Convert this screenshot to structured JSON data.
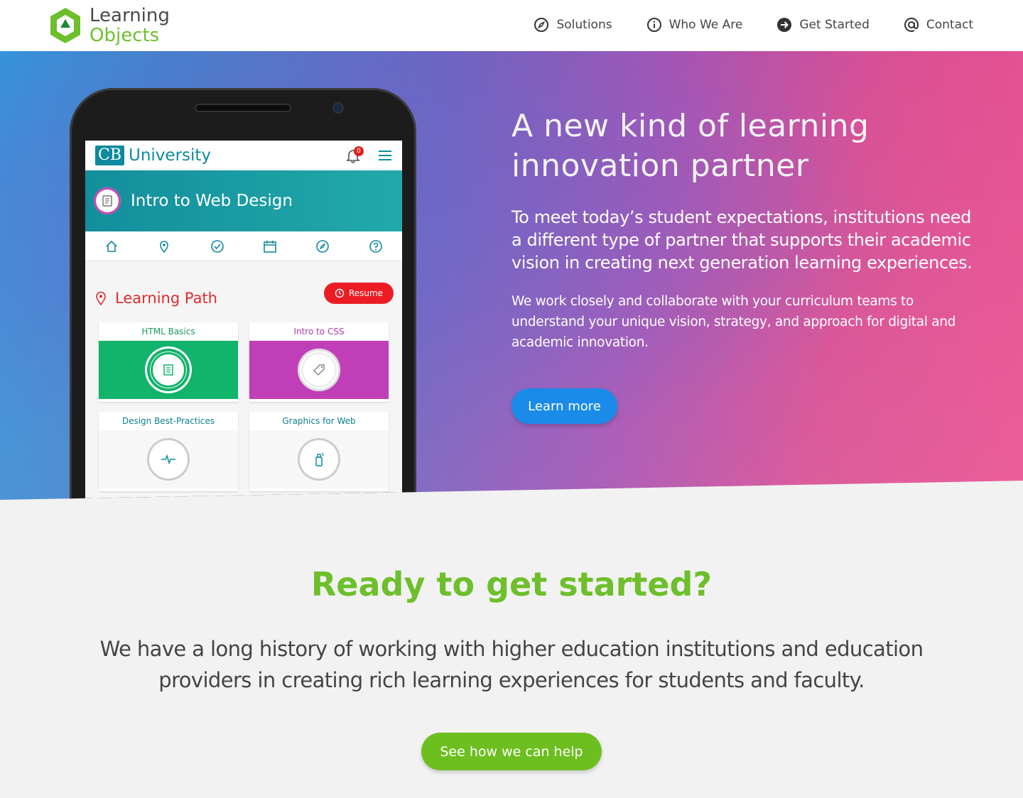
{
  "brand": {
    "line1": "Learning",
    "line2": "Objects",
    "colors": {
      "green": "#6dbf2b",
      "blue": "#1a8be8"
    }
  },
  "nav": {
    "items": [
      {
        "label": "Solutions",
        "icon": "compass-icon"
      },
      {
        "label": "Who We Are",
        "icon": "info-icon"
      },
      {
        "label": "Get Started",
        "icon": "arrow-right-circle-icon"
      },
      {
        "label": "Contact",
        "icon": "at-sign-icon"
      }
    ]
  },
  "hero": {
    "title": "A new kind of learning innovation partner",
    "lead": "To meet today’s student expectations, institutions need a different type of partner that supports their academic vision in creating next generation learning experiences.",
    "body": "We work closely and collaborate with your curriculum teams to understand your unique vision, strategy, and approach for digital and academic innovation.",
    "cta": "Learn more"
  },
  "phone_app": {
    "logo_mark": "CB",
    "logo_name": "University",
    "notification_count": "0",
    "course_title": "Intro to Web Design",
    "section_title": "Learning Path",
    "resume_label": "Resume",
    "cards": [
      {
        "title": "HTML Basics",
        "title_color": "#1a9a5a",
        "bg": "#12b36a",
        "icon": "document-icon"
      },
      {
        "title": "Intro to CSS",
        "title_color": "#b03aa8",
        "bg": "#c03fb8",
        "icon": "tag-icon"
      },
      {
        "title": "Design Best-Practices",
        "title_color": "#0e7f8e",
        "bg": "#f7f7f7",
        "icon": "pulse-icon"
      },
      {
        "title": "Graphics for Web",
        "title_color": "#0e7f8e",
        "bg": "#f7f7f7",
        "icon": "spray-icon"
      }
    ]
  },
  "cta_section": {
    "title": "Ready to get started?",
    "body": "We have a long history of working with higher education institutions and education providers in creating rich learning experiences for students and faculty.",
    "button": "See how we can help"
  }
}
